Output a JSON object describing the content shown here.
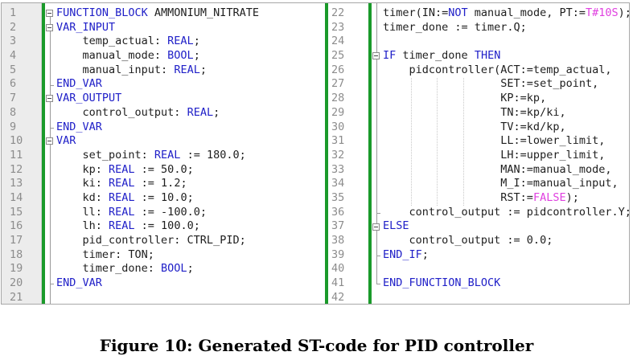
{
  "left_pane": {
    "line_numbers": [
      "1",
      "2",
      "3",
      "4",
      "5",
      "6",
      "7",
      "8",
      "9",
      "10",
      "11",
      "12",
      "13",
      "14",
      "15",
      "16",
      "17",
      "18",
      "19",
      "20",
      "21"
    ],
    "lines": [
      [
        {
          "t": "FUNCTION_BLOCK",
          "c": "kw"
        },
        {
          "t": " AMMONIUM_NITRATE"
        }
      ],
      [
        {
          "t": "VAR_INPUT",
          "c": "kw"
        }
      ],
      [
        {
          "t": "    temp_actual: "
        },
        {
          "t": "REAL",
          "c": "kw"
        },
        {
          "t": ";"
        }
      ],
      [
        {
          "t": "    manual_mode: "
        },
        {
          "t": "BOOL",
          "c": "kw"
        },
        {
          "t": ";"
        }
      ],
      [
        {
          "t": "    manual_input: "
        },
        {
          "t": "REAL",
          "c": "kw"
        },
        {
          "t": ";"
        }
      ],
      [
        {
          "t": "END_VAR",
          "c": "kw"
        }
      ],
      [
        {
          "t": "VAR_OUTPUT",
          "c": "kw"
        }
      ],
      [
        {
          "t": "    control_output: "
        },
        {
          "t": "REAL",
          "c": "kw"
        },
        {
          "t": ";"
        }
      ],
      [
        {
          "t": "END_VAR",
          "c": "kw"
        }
      ],
      [
        {
          "t": "VAR",
          "c": "kw"
        }
      ],
      [
        {
          "t": "    set_point: "
        },
        {
          "t": "REAL",
          "c": "kw"
        },
        {
          "t": " := 180.0;"
        }
      ],
      [
        {
          "t": "    kp: "
        },
        {
          "t": "REAL",
          "c": "kw"
        },
        {
          "t": " := 50.0;"
        }
      ],
      [
        {
          "t": "    ki: "
        },
        {
          "t": "REAL",
          "c": "kw"
        },
        {
          "t": " := 1.2;"
        }
      ],
      [
        {
          "t": "    kd: "
        },
        {
          "t": "REAL",
          "c": "kw"
        },
        {
          "t": " := 10.0;"
        }
      ],
      [
        {
          "t": "    ll: "
        },
        {
          "t": "REAL",
          "c": "kw"
        },
        {
          "t": " := -100.0;"
        }
      ],
      [
        {
          "t": "    lh: "
        },
        {
          "t": "REAL",
          "c": "kw"
        },
        {
          "t": " := 100.0;"
        }
      ],
      [
        {
          "t": "    pid_controller: CTRL_PID;"
        }
      ],
      [
        {
          "t": "    timer: TON;"
        }
      ],
      [
        {
          "t": "    timer_done: "
        },
        {
          "t": "BOOL",
          "c": "kw"
        },
        {
          "t": ";"
        }
      ],
      [
        {
          "t": "END_VAR",
          "c": "kw"
        }
      ],
      [
        {
          "t": ""
        }
      ]
    ]
  },
  "right_pane": {
    "line_numbers": [
      "22",
      "23",
      "24",
      "25",
      "26",
      "27",
      "28",
      "29",
      "30",
      "31",
      "32",
      "33",
      "34",
      "35",
      "36",
      "37",
      "38",
      "39",
      "40",
      "41",
      "42"
    ],
    "lines": [
      [
        {
          "t": "timer(IN:="
        },
        {
          "t": "NOT",
          "c": "kw"
        },
        {
          "t": " manual_mode, PT:="
        },
        {
          "t": "T#10S",
          "c": "lit"
        },
        {
          "t": ");"
        }
      ],
      [
        {
          "t": "timer_done := timer.Q;"
        }
      ],
      [
        {
          "t": ""
        }
      ],
      [
        {
          "t": "IF",
          "c": "kw"
        },
        {
          "t": " timer_done "
        },
        {
          "t": "THEN",
          "c": "kw"
        }
      ],
      [
        {
          "t": "    pidcontroller(ACT:=temp_actual,"
        }
      ],
      [
        {
          "t": "                  SET:=set_point,"
        }
      ],
      [
        {
          "t": "                  KP:=kp,"
        }
      ],
      [
        {
          "t": "                  TN:=kp/ki,"
        }
      ],
      [
        {
          "t": "                  TV:=kd/kp,"
        }
      ],
      [
        {
          "t": "                  LL:=lower_limit,"
        }
      ],
      [
        {
          "t": "                  LH:=upper_limit,"
        }
      ],
      [
        {
          "t": "                  MAN:=manual_mode,"
        }
      ],
      [
        {
          "t": "                  M_I:=manual_input,"
        }
      ],
      [
        {
          "t": "                  RST:="
        },
        {
          "t": "FALSE",
          "c": "lit"
        },
        {
          "t": ");"
        }
      ],
      [
        {
          "t": "    control_output := pidcontroller.Y;"
        }
      ],
      [
        {
          "t": "ELSE",
          "c": "kw"
        }
      ],
      [
        {
          "t": "    control_output := 0.0;"
        }
      ],
      [
        {
          "t": "END_IF",
          "c": "kw"
        },
        {
          "t": ";"
        }
      ],
      [
        {
          "t": ""
        }
      ],
      [
        {
          "t": "END_FUNCTION_BLOCK",
          "c": "kw"
        }
      ],
      [
        {
          "t": ""
        }
      ]
    ]
  },
  "caption": "Figure 10: Generated ST-code for PID controller",
  "colors": {
    "keyword": "#2020c8",
    "literal": "#e040e0",
    "change_bar": "#1a9a2a"
  }
}
